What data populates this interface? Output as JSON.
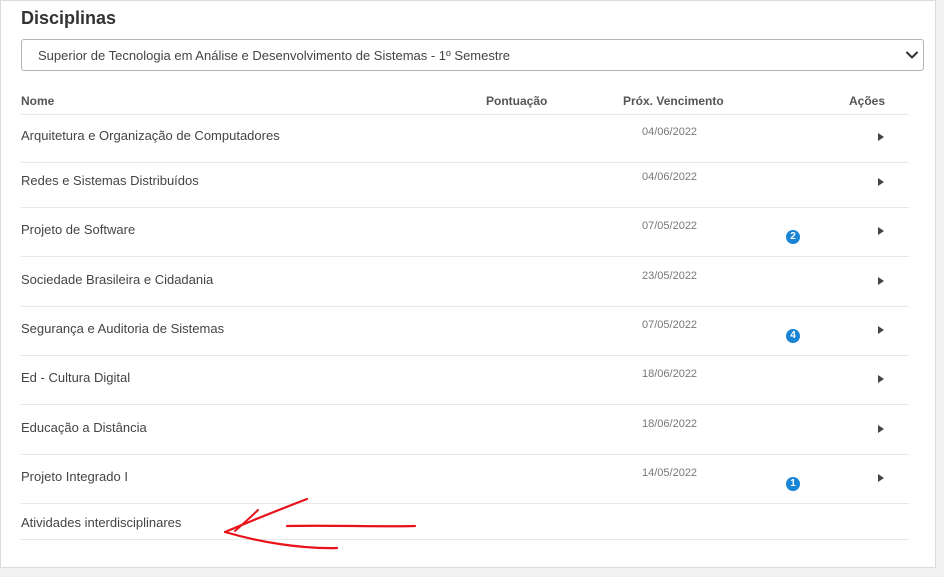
{
  "page": {
    "title": "Disciplinas"
  },
  "course_select": {
    "selected": "Superior de Tecnologia em Análise e Desenvolvimento de Sistemas - 1º Semestre"
  },
  "table": {
    "headers": {
      "name": "Nome",
      "score": "Pontuação",
      "next_due": "Próx. Vencimento",
      "actions": "Ações"
    },
    "rows": [
      {
        "name": "Arquitetura e Organização de Computadores",
        "due": "04/06/2022",
        "badge": ""
      },
      {
        "name": "Redes e Sistemas Distribuídos",
        "due": "04/06/2022",
        "badge": ""
      },
      {
        "name": "Projeto de Software",
        "due": "07/05/2022",
        "badge": "2"
      },
      {
        "name": "Sociedade Brasileira e Cidadania",
        "due": "23/05/2022",
        "badge": ""
      },
      {
        "name": "Segurança e Auditoria de Sistemas",
        "due": "07/05/2022",
        "badge": "4"
      },
      {
        "name": "Ed - Cultura Digital",
        "due": "18/06/2022",
        "badge": ""
      },
      {
        "name": "Educação a Distância",
        "due": "18/06/2022",
        "badge": ""
      },
      {
        "name": "Projeto Integrado I",
        "due": "14/05/2022",
        "badge": "1"
      }
    ],
    "extra_row": {
      "name": "Atividades interdisciplinares"
    }
  },
  "icons": {
    "select": "chevron-down-icon",
    "row_action": "caret-right-icon"
  },
  "colors": {
    "badge": "#1a85d6",
    "annotation": "#e8121b",
    "text": "#444444"
  }
}
